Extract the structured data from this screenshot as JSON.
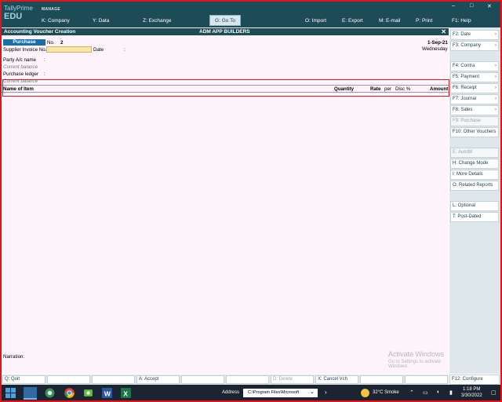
{
  "app": {
    "brand_line1": "TallyPrime",
    "brand_line2": "EDU",
    "manage": "MANAGE",
    "window_controls": [
      "–",
      "□",
      "✕"
    ]
  },
  "menu": {
    "company": "K: Company",
    "data": "Y: Data",
    "exchange": "Z: Exchange",
    "goto": "G: Go To",
    "import": "O: Import",
    "export": "E: Export",
    "email": "M: E-mail",
    "print": "P: Print",
    "help": "F1: Help"
  },
  "voucher_header": {
    "title": "Accounting Voucher Creation",
    "company": "ADM  APP BUILDERS",
    "close": "✕"
  },
  "voucher": {
    "type": "Purchase",
    "no_label": "No.",
    "no_value": "2",
    "date": "1-Sep-21",
    "day": "Wednesday",
    "supplier_invoice_label": "Supplier Invoice No.:",
    "supplier_invoice_value": "",
    "date_label": "Date",
    "date_sep": ":",
    "party_label": "Party A/c name",
    "party_sep": ":",
    "current_balance_1": "Current balance",
    "purchase_ledger_label": "Purchase ledger",
    "purchase_ledger_sep": ":",
    "current_balance_2": "Current balance",
    "narration_label": "Narration:"
  },
  "columns": {
    "name": "Name of Item",
    "quantity": "Quantity",
    "rate": "Rate",
    "per": "per",
    "disc": "Disc %",
    "amount": "Amount"
  },
  "sidebar": {
    "items": [
      {
        "label": "F2: Date",
        "disabled": false
      },
      {
        "label": "F3: Company",
        "disabled": false
      },
      {
        "label": "F4: Contra",
        "disabled": false
      },
      {
        "label": "F5: Payment",
        "disabled": false
      },
      {
        "label": "F6: Receipt",
        "disabled": false
      },
      {
        "label": "F7: Journal",
        "disabled": false
      },
      {
        "label": "F8: Sales",
        "disabled": false
      },
      {
        "label": "F9: Purchase",
        "disabled": true
      },
      {
        "label": "F10: Other Vouchers",
        "disabled": false
      },
      {
        "label": "E: Autofill",
        "disabled": true
      },
      {
        "label": "H: Change Mode",
        "disabled": false
      },
      {
        "label": "I: More Details",
        "disabled": false
      },
      {
        "label": "O: Related Reports",
        "disabled": false
      },
      {
        "label": "L: Optional",
        "disabled": false
      },
      {
        "label": "T: Post-Dated",
        "disabled": false
      }
    ],
    "f12": "F12: Configure"
  },
  "function_bar": {
    "quit": "Q: Quit",
    "accept": "A: Accept",
    "delete": "D: Delete",
    "cancel": "X: Cancel Vch"
  },
  "watermark": {
    "line1": "Activate Windows",
    "line2": "Go to Settings to activate Windows."
  },
  "taskbar": {
    "address_label": "Address",
    "address_value": "C:\\Program Files\\Microsoft",
    "weather": "32°C  Smoke",
    "time": "1:18 PM",
    "date": "3/30/2022"
  }
}
